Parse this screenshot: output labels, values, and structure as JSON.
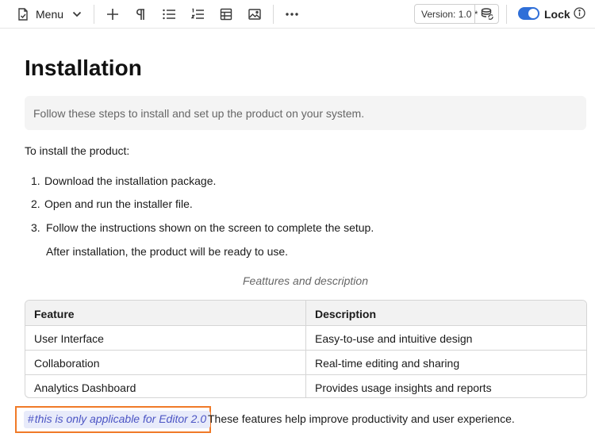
{
  "toolbar": {
    "menu_label": "Menu",
    "version_label": "Version: 1.0 *",
    "lock_label": "Lock",
    "lock_enabled": true,
    "accent_color": "#2f6fd8",
    "icons": [
      "document-check-icon",
      "chevron-down-icon",
      "plus-icon",
      "paragraph-icon",
      "bullet-list-icon",
      "numbered-list-icon",
      "table-icon",
      "image-icon",
      "more-icon",
      "database-sync-icon",
      "info-icon"
    ]
  },
  "doc": {
    "title": "Installation",
    "callout": "Follow these steps to install and set up the product on your system.",
    "intro": "To install the product:",
    "steps": [
      {
        "num": "1.",
        "text": "Download the installation package."
      },
      {
        "num": "2.",
        "text": "Open and run the installer file."
      },
      {
        "num": "3.",
        "text": "Follow the instructions shown on the screen to complete the setup."
      }
    ],
    "after": "After installation, the product will be ready to use.",
    "caption": "Feattures and description",
    "table": {
      "headers": [
        "Feature",
        "Description"
      ],
      "rows": [
        [
          "User Interface",
          "Easy-to-use and intuitive design"
        ],
        [
          "Collaboration",
          "Real-time editing and sharing"
        ],
        [
          "Analytics Dashboard",
          "Provides usage insights and reports"
        ]
      ]
    },
    "tag_hash": "#",
    "tag_text": "this is only applicable for Editor 2.0",
    "tail_text": "These features help improve productivity and user experience.",
    "highlight_color": "#f07a28"
  }
}
